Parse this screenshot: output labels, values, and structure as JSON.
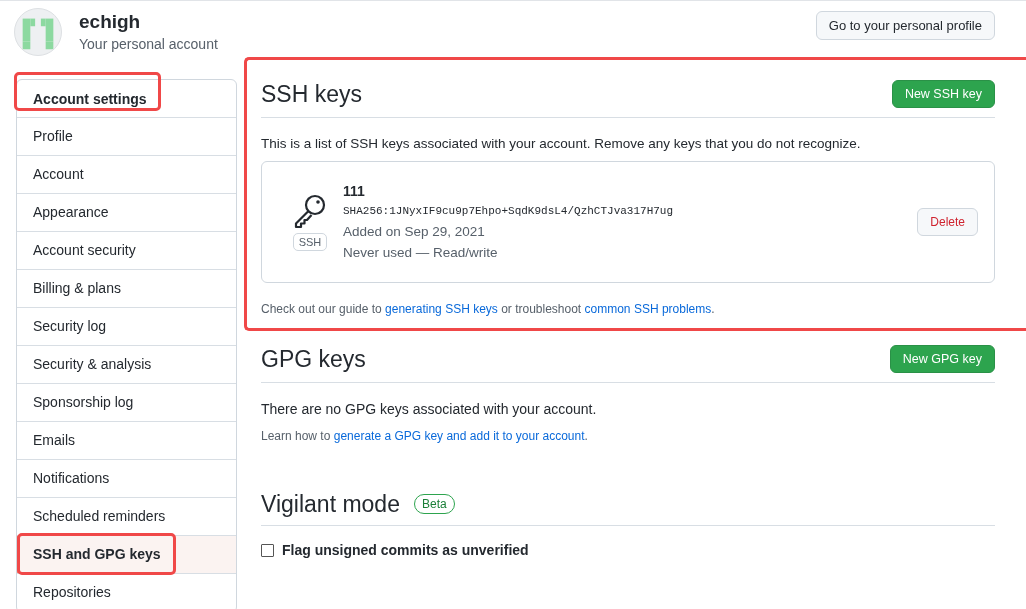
{
  "account": {
    "name": "echigh",
    "subtitle": "Your personal account",
    "profile_button": "Go to your personal profile"
  },
  "sidebar": {
    "header": {
      "label": "Account settings",
      "highlighted": true
    },
    "items": [
      {
        "label": "Profile",
        "selected": false,
        "highlighted": false
      },
      {
        "label": "Account",
        "selected": false,
        "highlighted": false
      },
      {
        "label": "Appearance",
        "selected": false,
        "highlighted": false
      },
      {
        "label": "Account security",
        "selected": false,
        "highlighted": false
      },
      {
        "label": "Billing & plans",
        "selected": false,
        "highlighted": false
      },
      {
        "label": "Security log",
        "selected": false,
        "highlighted": false
      },
      {
        "label": "Security & analysis",
        "selected": false,
        "highlighted": false
      },
      {
        "label": "Sponsorship log",
        "selected": false,
        "highlighted": false
      },
      {
        "label": "Emails",
        "selected": false,
        "highlighted": false
      },
      {
        "label": "Notifications",
        "selected": false,
        "highlighted": false
      },
      {
        "label": "Scheduled reminders",
        "selected": false,
        "highlighted": false
      },
      {
        "label": "SSH and GPG keys",
        "selected": true,
        "highlighted": true
      },
      {
        "label": "Repositories",
        "selected": false,
        "highlighted": false
      }
    ]
  },
  "ssh": {
    "title": "SSH keys",
    "button": "New SSH key",
    "highlighted": true,
    "description": "This is a list of SSH keys associated with your account. Remove any keys that you do not recognize.",
    "keys": [
      {
        "name": "111",
        "badge": "SSH",
        "fingerprint": "SHA256:1JNyxIF9cu9p7Ehpo+SqdK9dsL4/QzhCTJva317H7ug",
        "added": "Added on Sep 29, 2021",
        "usage": "Never used — Read/write",
        "delete": "Delete"
      }
    ],
    "guide": [
      {
        "kind": "text",
        "text": "Check out our guide to "
      },
      {
        "kind": "link",
        "text": "generating SSH keys"
      },
      {
        "kind": "text",
        "text": " or troubleshoot "
      },
      {
        "kind": "link",
        "text": "common SSH problems"
      },
      {
        "kind": "text",
        "text": "."
      }
    ]
  },
  "gpg": {
    "title": "GPG keys",
    "button": "New GPG key",
    "empty": "There are no GPG keys associated with your account.",
    "guide": [
      {
        "kind": "text",
        "text": "Learn how to "
      },
      {
        "kind": "link",
        "text": "generate a GPG key and add it to your account"
      },
      {
        "kind": "text",
        "text": "."
      }
    ]
  },
  "vigilant": {
    "title": "Vigilant mode",
    "badge": "Beta",
    "option": {
      "label": "Flag unsigned commits as unverified",
      "checked": false
    }
  }
}
